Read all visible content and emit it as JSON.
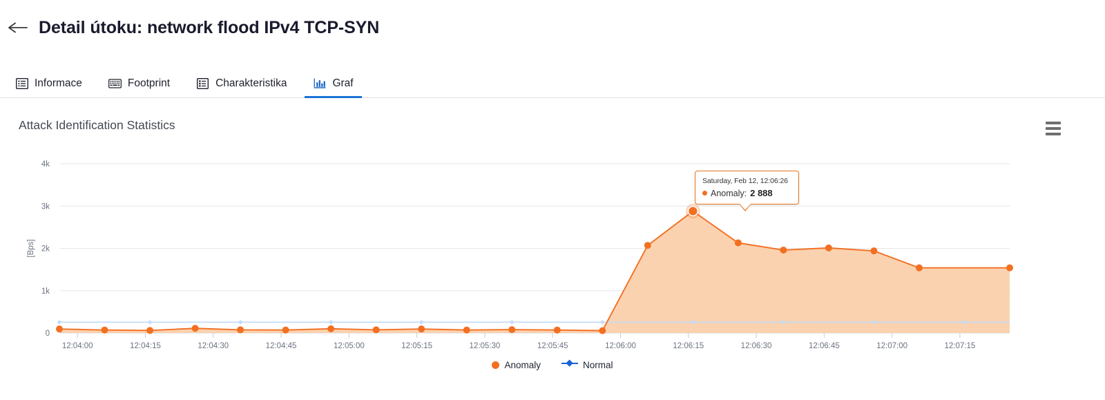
{
  "header": {
    "back_icon": "arrow-left-icon",
    "title": "Detail útoku: network flood IPv4 TCP-SYN"
  },
  "tabs": [
    {
      "label": "Informace",
      "icon": "list-icon",
      "active": false
    },
    {
      "label": "Footprint",
      "icon": "keyboard-icon",
      "active": false
    },
    {
      "label": "Charakteristika",
      "icon": "table-list-icon",
      "active": false
    },
    {
      "label": "Graf",
      "icon": "bar-chart-icon",
      "active": true
    }
  ],
  "chart_panel": {
    "title": "Attack Identification Statistics",
    "menu_icon": "hamburger-menu-icon"
  },
  "tooltip": {
    "time": "Saturday, Feb 12, 12:06:26",
    "series": "Anomaly:",
    "value": "2 888",
    "dot_color": "#f36f21",
    "border_color": "#e8741a"
  },
  "legend": [
    {
      "label": "Anomaly",
      "color": "#f36f21",
      "marker": "circle"
    },
    {
      "label": "Normal",
      "color": "#1463d2",
      "marker": "diamond-line"
    }
  ],
  "colors": {
    "accent_blue": "#1a73d4",
    "anomaly": "#f36f21",
    "anomaly_fill": "#fbcda6",
    "normal": "#1463d2",
    "normal_light": "#c3dcf7",
    "grid": "#e6e6ea",
    "axis_text": "#6b7280"
  },
  "chart_data": {
    "type": "area",
    "title": "Attack Identification Statistics",
    "xlabel": "",
    "ylabel": "[Bps]",
    "ylim": [
      0,
      4000
    ],
    "yticks": [
      0,
      1000,
      2000,
      3000,
      4000
    ],
    "yticklabels": [
      "0",
      "1k",
      "2k",
      "3k",
      "4k"
    ],
    "xticklabels": [
      "12:04:00",
      "12:04:15",
      "12:04:30",
      "12:04:45",
      "12:05:00",
      "12:05:15",
      "12:05:30",
      "12:05:45",
      "12:06:00",
      "12:06:15",
      "12:06:30",
      "12:06:45",
      "12:07:00",
      "12:07:15"
    ],
    "xrange": [
      "12:03:56",
      "12:07:26"
    ],
    "grid": true,
    "legend_position": "bottom",
    "x": [
      "12:03:56",
      "12:04:06",
      "12:04:16",
      "12:04:26",
      "12:04:36",
      "12:04:46",
      "12:04:56",
      "12:05:06",
      "12:05:16",
      "12:05:26",
      "12:05:36",
      "12:05:46",
      "12:05:56",
      "12:06:06",
      "12:06:16",
      "12:06:26",
      "12:06:36",
      "12:06:46",
      "12:06:56",
      "12:07:06",
      "12:07:16",
      "12:07:26"
    ],
    "series": [
      {
        "name": "Anomaly",
        "color": "#f36f21",
        "fill": "#fbcda6",
        "values": [
          95,
          70,
          60,
          110,
          75,
          70,
          100,
          75,
          95,
          70,
          80,
          70,
          55,
          2070,
          2880,
          2130,
          1960,
          2010,
          1940,
          1540,
          1540,
          1540
        ]
      },
      {
        "name": "Normal",
        "color": "#c3dcf7",
        "values": [
          255,
          255,
          255,
          255,
          255,
          255,
          255,
          255,
          255,
          255,
          255,
          255,
          255,
          255,
          255,
          255,
          255,
          255,
          255,
          255,
          255,
          255
        ]
      }
    ],
    "highlight_point": {
      "series": "Anomaly",
      "x": "12:06:26",
      "y": 2888
    }
  }
}
